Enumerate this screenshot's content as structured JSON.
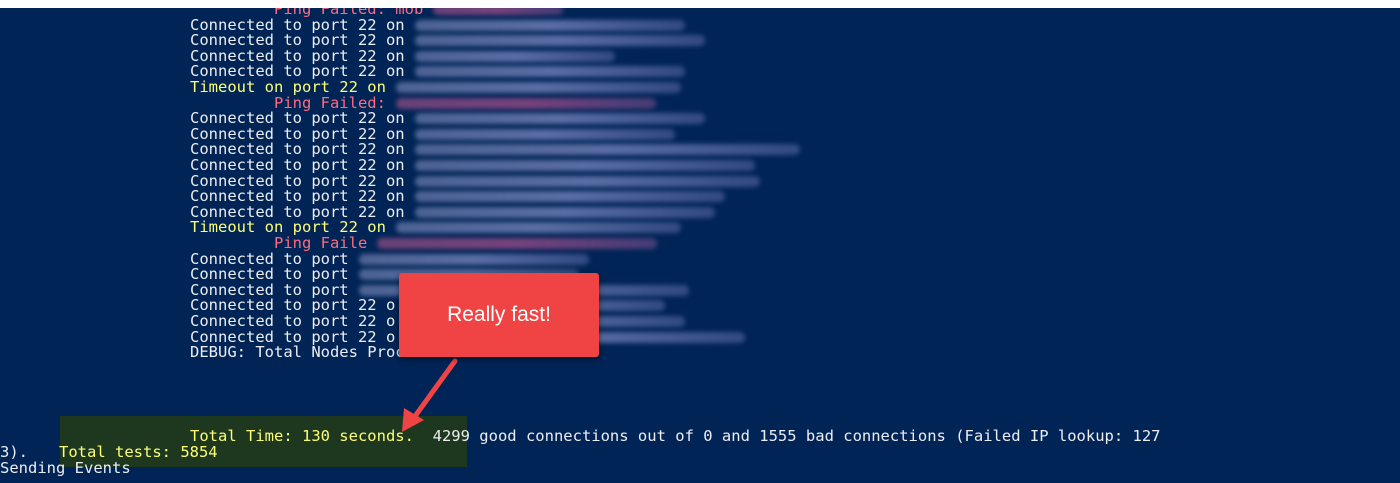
{
  "console": {
    "lines": [
      {
        "text": "         Ping Failed: mob",
        "color": "red",
        "blur": 130
      },
      {
        "text": "Connected to port 22 on",
        "color": "white",
        "blur": 270
      },
      {
        "text": "Connected to port 22 on",
        "color": "white",
        "blur": 290
      },
      {
        "text": "Connected to port 22 on",
        "color": "white",
        "blur": 200
      },
      {
        "text": "Connected to port 22 on",
        "color": "white",
        "blur": 270
      },
      {
        "text": "Timeout on port 22 on",
        "color": "yellow",
        "blur": 285
      },
      {
        "text": "         Ping Failed:",
        "color": "red",
        "blur": 260
      },
      {
        "text": "Connected to port 22 on",
        "color": "white",
        "blur": 290
      },
      {
        "text": "Connected to port 22 on",
        "color": "white",
        "blur": 260
      },
      {
        "text": "Connected to port 22 on",
        "color": "white",
        "blur": 385
      },
      {
        "text": "Connected to port 22 on",
        "color": "white",
        "blur": 340
      },
      {
        "text": "Connected to port 22 on",
        "color": "white",
        "blur": 345
      },
      {
        "text": "Connected to port 22 on",
        "color": "white",
        "blur": 310
      },
      {
        "text": "Connected to port 22 on",
        "color": "white",
        "blur": 300
      },
      {
        "text": "Timeout on port 22 on",
        "color": "yellow",
        "blur": 285
      },
      {
        "text": "         Ping Faile",
        "color": "red",
        "blur": 280
      },
      {
        "text": "Connected to port",
        "color": "white",
        "blur": 230
      },
      {
        "text": "Connected to port",
        "color": "white",
        "blur": 220
      },
      {
        "text": "Connected to port",
        "color": "white",
        "blur": 330
      },
      {
        "text": "Connected to port 22 o",
        "color": "white",
        "blur": 260
      },
      {
        "text": "Connected to port 22 o",
        "color": "white",
        "blur": 280
      },
      {
        "text": "Connected to port 22 o",
        "color": "white",
        "blur": 340
      },
      {
        "text": "DEBUG: Total Nodes Processed:0",
        "color": "white",
        "blur": 0
      }
    ],
    "total_time": "Total Time: 130 seconds.",
    "summary": "  4299 good connections out of 0 and 1555 bad connections (Failed IP lookup: 127",
    "wrap_prefix": "3).",
    "total_tests": "Total tests: 5854",
    "sending": "Sending Events"
  },
  "annotation": {
    "label": "Really fast!",
    "colors": {
      "callout": "#f04444",
      "arrow": "#f04444"
    }
  },
  "colors": {
    "background": "#012456",
    "text": "#eeedf0",
    "warning": "#fefe77",
    "error": "#ff6b80"
  }
}
